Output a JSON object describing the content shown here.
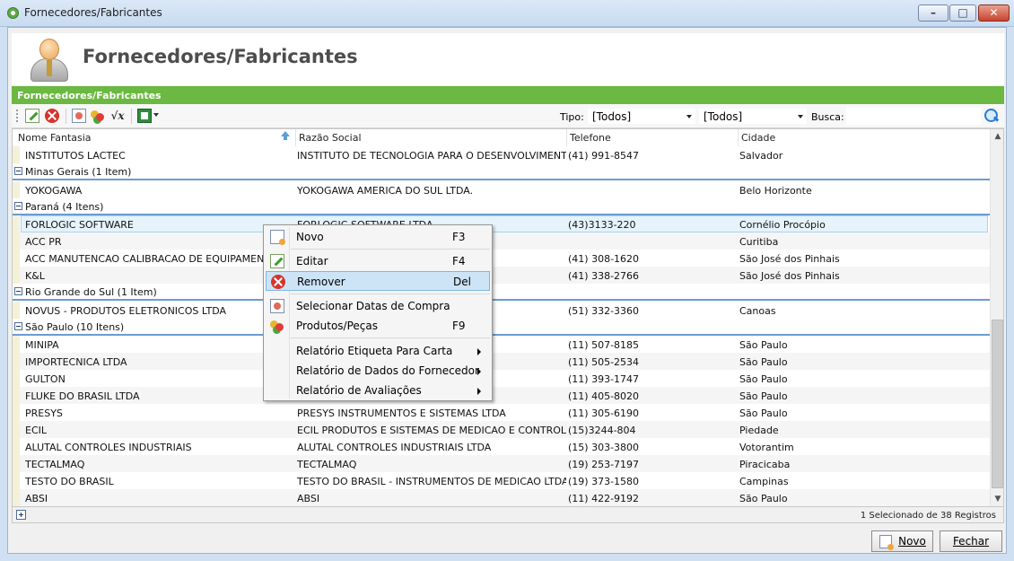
{
  "window": {
    "title": "Fornecedores/Fabricantes",
    "minimize": "–",
    "maximize": "□",
    "close": "✕"
  },
  "header": {
    "title": "Fornecedores/Fabricantes",
    "icon": "supplier-person-icon"
  },
  "section": {
    "title": "Fornecedores/Fabricantes"
  },
  "toolbar": {
    "icons": [
      "edit-icon",
      "delete-icon",
      "calendar-icon",
      "products-icon",
      "formula-icon",
      "excel-export-icon"
    ],
    "fx_glyph": "√x",
    "tipo_label": "Tipo:",
    "tipo_value": "[Todos]",
    "second_value": "[Todos]",
    "busca_label": "Busca:",
    "busca_value": ""
  },
  "grid": {
    "columns": [
      "Nome Fantasia",
      "Razão Social",
      "Telefone",
      "Cidade"
    ],
    "rows": [
      {
        "type": "row",
        "cells": [
          "INSTITUTOS LACTEC",
          "INSTITUTO DE TECNOLOGIA PARA O DESENVOLVIMENTO",
          "(41) 991-8547",
          "Salvador"
        ]
      },
      {
        "type": "group",
        "label": "Minas Gerais (1 Item)"
      },
      {
        "type": "row",
        "cells": [
          "YOKOGAWA",
          "YOKOGAWA AMERICA DO SUL LTDA.",
          "",
          "Belo Horizonte"
        ]
      },
      {
        "type": "group",
        "label": "Paraná (4 Itens)"
      },
      {
        "type": "row",
        "selected": true,
        "cells": [
          "FORLOGIC SOFTWARE",
          "FORLOGIC SOFTWARE LTDA",
          "(43)3133-220",
          "Cornélio Procópio"
        ]
      },
      {
        "type": "row",
        "cells": [
          "ACC PR",
          "",
          "",
          "Curitiba"
        ]
      },
      {
        "type": "row",
        "cells": [
          "ACC MANUTENCAO CALIBRACAO DE EQUIPAMENTOS",
          "",
          "(41) 308-1620",
          "São José dos Pinhais"
        ]
      },
      {
        "type": "row",
        "cells": [
          "K&L",
          "",
          "(41) 338-2766",
          "São José dos Pinhais"
        ]
      },
      {
        "type": "group",
        "label": "Rio Grande do Sul (1 Item)"
      },
      {
        "type": "row",
        "cells": [
          "NOVUS - PRODUTOS ELETRONICOS LTDA",
          "",
          "(51) 332-3360",
          "Canoas"
        ]
      },
      {
        "type": "group",
        "label": "São Paulo (10 Itens)"
      },
      {
        "type": "row",
        "cells": [
          "MINIPA",
          "",
          "(11) 507-8185",
          "São Paulo"
        ]
      },
      {
        "type": "row",
        "cells": [
          "IMPORTECNICA LTDA",
          "",
          "(11) 505-2534",
          "São Paulo"
        ]
      },
      {
        "type": "row",
        "cells": [
          "GULTON",
          "",
          "(11) 393-1747",
          "São Paulo"
        ]
      },
      {
        "type": "row",
        "cells": [
          "FLUKE DO BRASIL LTDA",
          "",
          "(11) 405-8020",
          "São Paulo"
        ]
      },
      {
        "type": "row",
        "cells": [
          "PRESYS",
          "PRESYS INSTRUMENTOS E SISTEMAS LTDA",
          "(11) 305-6190",
          "São Paulo"
        ]
      },
      {
        "type": "row",
        "cells": [
          "ECIL",
          "ECIL PRODUTOS E SISTEMAS DE MEDICAO E CONTROLE ...",
          "(15)3244-804",
          "Piedade"
        ]
      },
      {
        "type": "row",
        "cells": [
          "ALUTAL CONTROLES INDUSTRIAIS",
          "ALUTAL CONTROLES INDUSTRIAIS LTDA",
          "(15) 303-3800",
          "Votorantim"
        ]
      },
      {
        "type": "row",
        "cells": [
          "TECTALMAQ",
          "TECTALMAQ",
          "(19) 253-7197",
          "Piracicaba"
        ]
      },
      {
        "type": "row",
        "cells": [
          "TESTO DO BRASIL",
          "TESTO DO BRASIL - INSTRUMENTOS DE MEDICAO LTDA",
          "(19) 373-1580",
          "Campinas"
        ]
      },
      {
        "type": "row",
        "cells": [
          "ABSI",
          "ABSI",
          "(11) 422-9192",
          "São Paulo"
        ]
      }
    ],
    "scroll_up": "▲",
    "scroll_down": "▼",
    "footer_count": "1 Selecionado de 38 Registros"
  },
  "context_menu": {
    "items": [
      {
        "label": "Novo",
        "shortcut": "F3",
        "icon": "new-icon"
      },
      {
        "label": "Editar",
        "shortcut": "F4",
        "icon": "edit-icon"
      },
      {
        "label": "Remover",
        "shortcut": "Del",
        "icon": "delete-icon",
        "highlighted": true
      },
      {
        "label": "Selecionar Datas de Compra",
        "shortcut": "",
        "icon": "calendar-icon"
      },
      {
        "label": "Produtos/Peças",
        "shortcut": "F9",
        "icon": "products-icon"
      },
      {
        "label": "Relatório Etiqueta Para Carta",
        "shortcut": "",
        "submenu": true
      },
      {
        "label": "Relatório de Dados do Fornecedor",
        "shortcut": "",
        "submenu": true
      },
      {
        "label": "Relatório de Avaliações",
        "shortcut": "",
        "submenu": true
      }
    ]
  },
  "buttons": {
    "novo": "Novo",
    "fechar": "Fechar"
  }
}
